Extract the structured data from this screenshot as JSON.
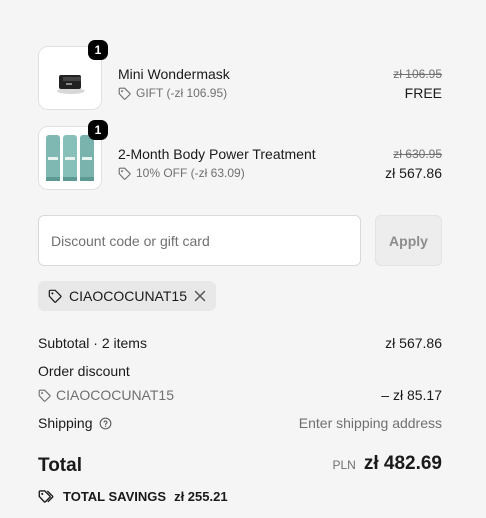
{
  "items": [
    {
      "name": "Mini Wondermask",
      "quantity": "1",
      "discount": "GIFT (-zł 106.95)",
      "original_price": "zł 106.95",
      "price": "FREE",
      "thumb_icon": "black-jar-image"
    },
    {
      "name": "2-Month Body Power Treatment",
      "quantity": "1",
      "discount": "10% OFF (-zł 63.09)",
      "original_price": "zł 630.95",
      "price": "zł 567.86",
      "thumb_icon": "teal-tubes-image"
    }
  ],
  "discount_field": {
    "placeholder": "Discount code or gift card",
    "value": "",
    "apply_label": "Apply"
  },
  "applied_code": {
    "code": "CIAOCOCUNAT15",
    "remove_icon": "close-icon"
  },
  "summary": {
    "subtotal_label": "Subtotal · 2 items",
    "subtotal_value": "zł 567.86",
    "order_discount_label": "Order discount",
    "order_discount_code": "CIAOCOCUNAT15",
    "order_discount_value": "– zł 85.17",
    "shipping_label": "Shipping",
    "shipping_value": "Enter shipping address",
    "total_label": "Total",
    "currency": "PLN",
    "total_value": "zł 482.69",
    "savings_label": "TOTAL SAVINGS",
    "savings_value": "zł 255.21"
  },
  "colors": {
    "background": "#f5f5f5",
    "text": "#1a1a1a",
    "muted": "#707070",
    "badge": "#000000"
  }
}
